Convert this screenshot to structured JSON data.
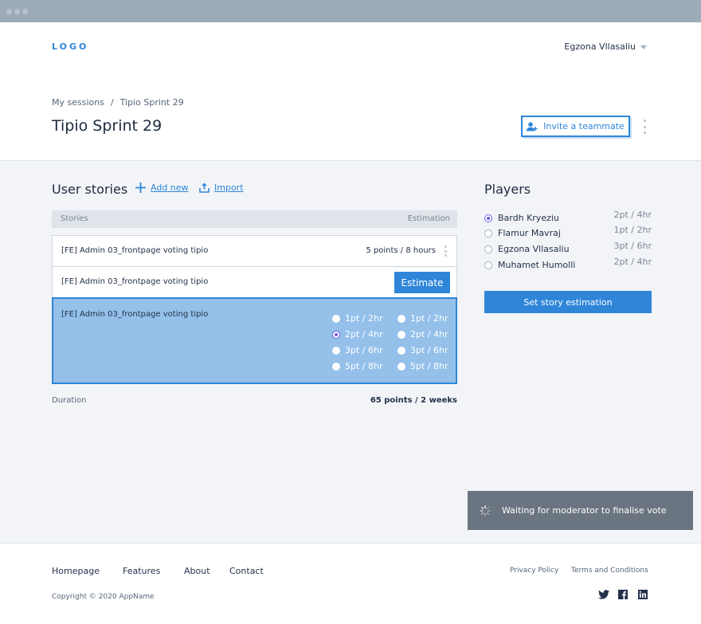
{
  "header": {
    "logo": "LOGO",
    "user_name": "Egzona Vllasaliu"
  },
  "breadcrumb": {
    "root": "My sessions",
    "separator": "/",
    "current": "Tipio Sprint 29"
  },
  "page": {
    "title": "Tipio Sprint 29",
    "invite_label": "Invite a teammate"
  },
  "stories": {
    "heading": "User stories",
    "add_label": "Add new",
    "import_label": "Import",
    "col_stories": "Stories",
    "col_estimation": "Estimation",
    "rows": [
      {
        "name": "[FE] Admin 03_frontpage voting tipio",
        "estimation": "5 points / 8 hours"
      },
      {
        "name": "[FE] Admin 03_frontpage voting tipio",
        "button": "Estimate"
      },
      {
        "name": "[FE] Admin 03_frontpage voting tipio"
      }
    ],
    "options_left": [
      "1pt / 2hr",
      "2pt / 4hr",
      "3pt / 6hr",
      "5pt / 8hr"
    ],
    "options_right": [
      "1pt / 2hr",
      "2pt / 4hr",
      "3pt / 6hr",
      "5pt / 8hr"
    ],
    "selected_option": "2pt / 4hr",
    "duration_label": "Duration",
    "duration_value": "65 points / 2 weeks"
  },
  "players": {
    "heading": "Players",
    "list": [
      {
        "name": "Bardh Kryeziu",
        "vote": "2pt / 4hr",
        "selected": true
      },
      {
        "name": "Flamur Mavraj",
        "vote": "1pt / 2hr",
        "selected": false
      },
      {
        "name": "Egzona Vllasaliu",
        "vote": "3pt / 6hr",
        "selected": false
      },
      {
        "name": "Muhamet Humolli",
        "vote": "2pt / 4hr",
        "selected": false
      }
    ],
    "set_button": "Set story estimation"
  },
  "toast": {
    "message": "Waiting for moderator to finalise vote"
  },
  "footer": {
    "nav": [
      "Homepage",
      "Features",
      "About",
      "Contact"
    ],
    "copyright": "Copyright © 2020 AppName",
    "privacy": "Privacy Policy",
    "terms": "Terms and Conditions",
    "social_icons": [
      "twitter-icon",
      "facebook-icon",
      "linkedin-icon"
    ]
  },
  "colors": {
    "accent": "#2f86d9",
    "selected_row": "#94c0ea",
    "radio_selected": "#6b5ce7",
    "toast_bg": "#6b7581"
  }
}
